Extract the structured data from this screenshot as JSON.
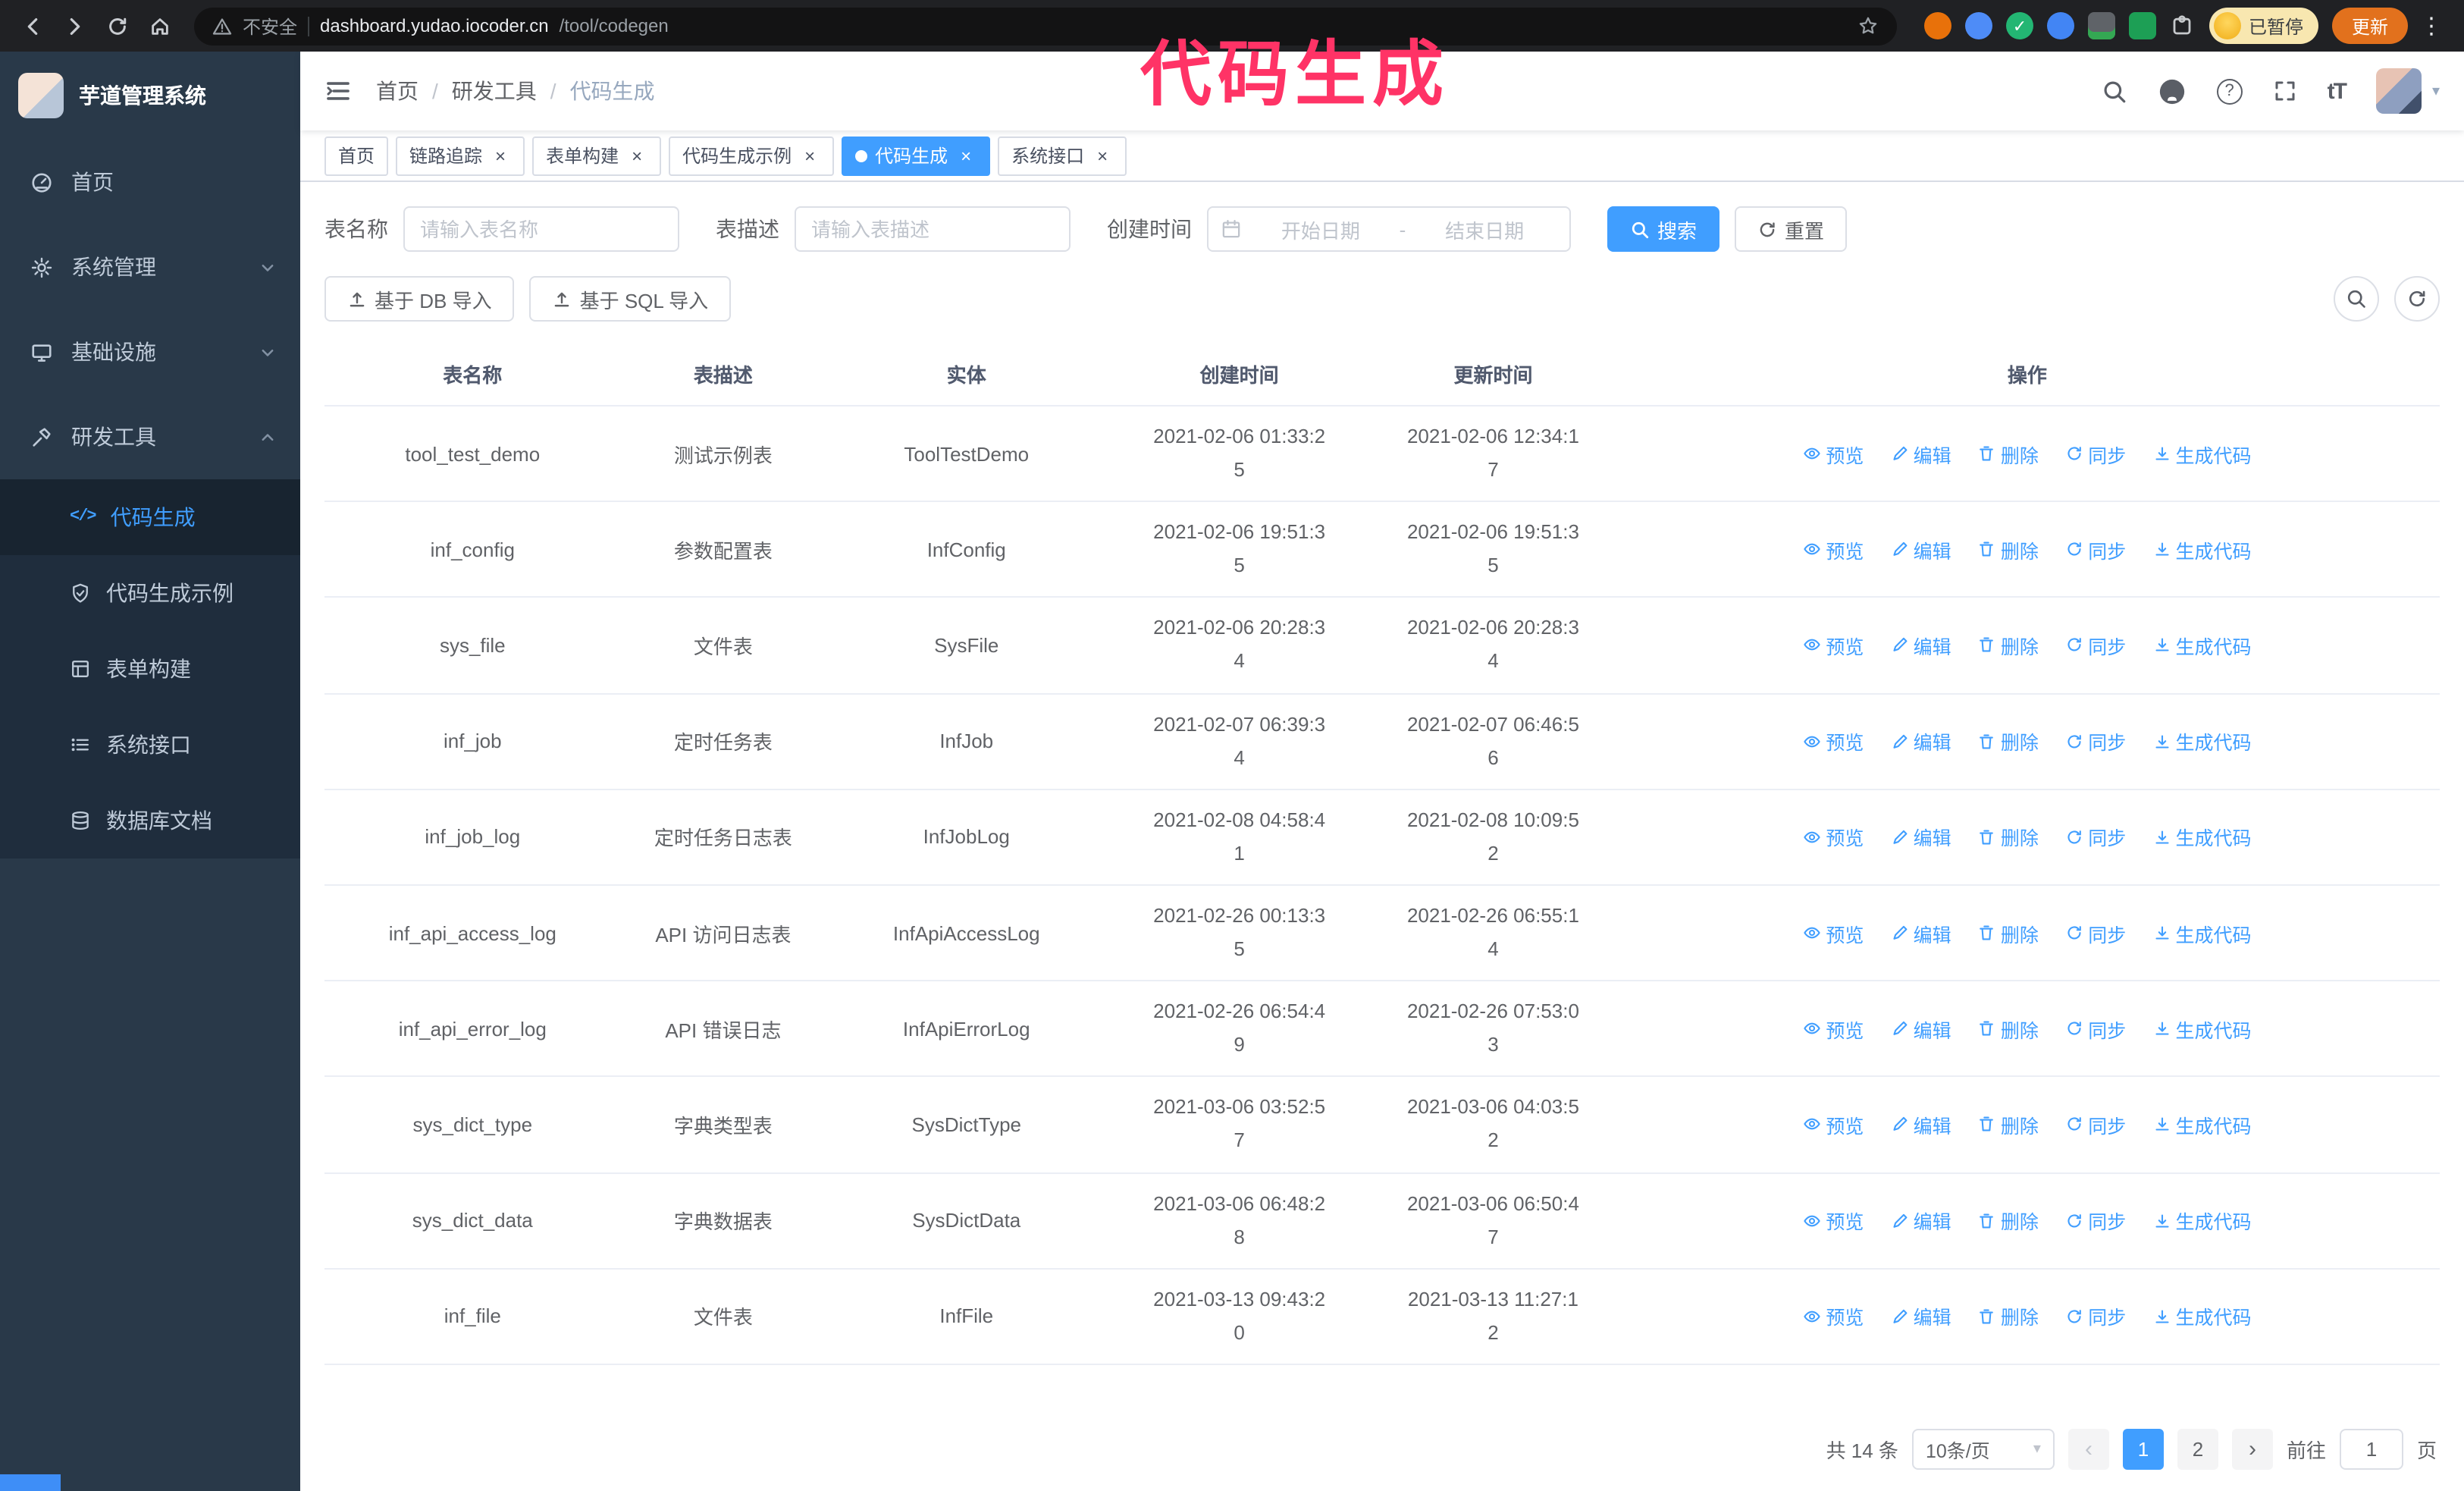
{
  "colors": {
    "primary": "#409eff",
    "link_blue": "#409eff",
    "tab_active": "#409eff",
    "annotation_pink": "#ff3366",
    "sidebar_bg": "#293949",
    "sidebar_sub_bg": "#1f2d3d",
    "chrome_bg": "#202124",
    "update_orange": "#e2711d",
    "paused_yellow": "#f8e7b0"
  },
  "annotation": {
    "text": "代码生成"
  },
  "chrome": {
    "security": "不安全",
    "host": "dashboard.yudao.iocoder.cn",
    "path": "/tool/codegen",
    "paused_badge": "已暂停",
    "update_button": "更新"
  },
  "sidebar": {
    "title": "芋道管理系统",
    "items": [
      {
        "label": "首页"
      },
      {
        "label": "系统管理"
      },
      {
        "label": "基础设施"
      },
      {
        "label": "研发工具"
      }
    ],
    "sub": [
      {
        "label": "代码生成"
      },
      {
        "label": "代码生成示例"
      },
      {
        "label": "表单构建"
      },
      {
        "label": "系统接口"
      },
      {
        "label": "数据库文档"
      }
    ]
  },
  "navbar": {
    "breadcrumb": [
      "首页",
      "研发工具",
      "代码生成"
    ],
    "font_size_icon": "tT"
  },
  "tabs": [
    {
      "label": "首页",
      "closable": false,
      "active": false
    },
    {
      "label": "链路追踪",
      "closable": true,
      "active": false
    },
    {
      "label": "表单构建",
      "closable": true,
      "active": false
    },
    {
      "label": "代码生成示例",
      "closable": true,
      "active": false
    },
    {
      "label": "代码生成",
      "closable": true,
      "active": true
    },
    {
      "label": "系统接口",
      "closable": true,
      "active": false
    }
  ],
  "search": {
    "table_name_label": "表名称",
    "table_name_placeholder": "请输入表名称",
    "table_desc_label": "表描述",
    "table_desc_placeholder": "请输入表描述",
    "create_time_label": "创建时间",
    "date_start_placeholder": "开始日期",
    "date_separator": "-",
    "date_end_placeholder": "结束日期",
    "search_button": "搜索",
    "reset_button": "重置"
  },
  "toolbar": {
    "import_db": "基于 DB 导入",
    "import_sql": "基于 SQL 导入"
  },
  "table": {
    "columns": [
      "表名称",
      "表描述",
      "实体",
      "创建时间",
      "更新时间",
      "操作"
    ],
    "actions": [
      "预览",
      "编辑",
      "删除",
      "同步",
      "生成代码"
    ],
    "rows": [
      {
        "name": "tool_test_demo",
        "desc": "测试示例表",
        "entity": "ToolTestDemo",
        "created": "2021-02-06 01:33:25",
        "updated": "2021-02-06 12:34:17"
      },
      {
        "name": "inf_config",
        "desc": "参数配置表",
        "entity": "InfConfig",
        "created": "2021-02-06 19:51:35",
        "updated": "2021-02-06 19:51:35"
      },
      {
        "name": "sys_file",
        "desc": "文件表",
        "entity": "SysFile",
        "created": "2021-02-06 20:28:34",
        "updated": "2021-02-06 20:28:34"
      },
      {
        "name": "inf_job",
        "desc": "定时任务表",
        "entity": "InfJob",
        "created": "2021-02-07 06:39:34",
        "updated": "2021-02-07 06:46:56"
      },
      {
        "name": "inf_job_log",
        "desc": "定时任务日志表",
        "entity": "InfJobLog",
        "created": "2021-02-08 04:58:41",
        "updated": "2021-02-08 10:09:52"
      },
      {
        "name": "inf_api_access_log",
        "desc": "API 访问日志表",
        "entity": "InfApiAccessLog",
        "created": "2021-02-26 00:13:35",
        "updated": "2021-02-26 06:55:14"
      },
      {
        "name": "inf_api_error_log",
        "desc": "API 错误日志",
        "entity": "InfApiErrorLog",
        "created": "2021-02-26 06:54:49",
        "updated": "2021-02-26 07:53:03"
      },
      {
        "name": "sys_dict_type",
        "desc": "字典类型表",
        "entity": "SysDictType",
        "created": "2021-03-06 03:52:57",
        "updated": "2021-03-06 04:03:52"
      },
      {
        "name": "sys_dict_data",
        "desc": "字典数据表",
        "entity": "SysDictData",
        "created": "2021-03-06 06:48:28",
        "updated": "2021-03-06 06:50:47"
      },
      {
        "name": "inf_file",
        "desc": "文件表",
        "entity": "InfFile",
        "created": "2021-03-13 09:43:20",
        "updated": "2021-03-13 11:27:12"
      }
    ]
  },
  "pagination": {
    "total": "共 14 条",
    "page_size": "10条/页",
    "pages": [
      "1",
      "2"
    ],
    "active_page": "1",
    "goto_label": "前往",
    "goto_value": "1",
    "goto_suffix": "页"
  }
}
